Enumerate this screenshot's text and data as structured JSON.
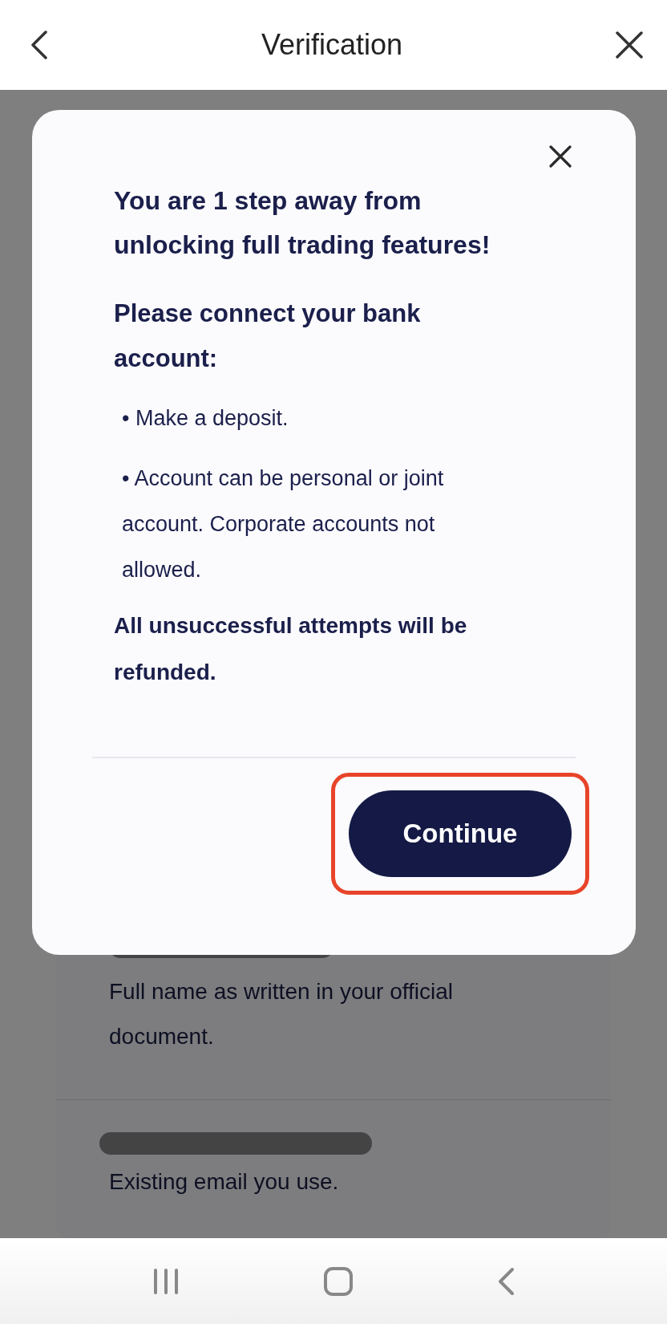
{
  "header": {
    "title": "Verification"
  },
  "background": {
    "fields": [
      {
        "description": "Full name as written in your official document."
      },
      {
        "description": "Existing email you use."
      }
    ]
  },
  "dialog": {
    "heading": "You are 1 step away from unlocking full trading features!",
    "subheading": "Please connect your bank account:",
    "bullets": [
      "• Make a deposit.",
      "• Account can be personal or joint account. Corporate accounts not allowed."
    ],
    "note": "All unsuccessful attempts will be refunded.",
    "button": "Continue",
    "button_highlighted": true
  }
}
